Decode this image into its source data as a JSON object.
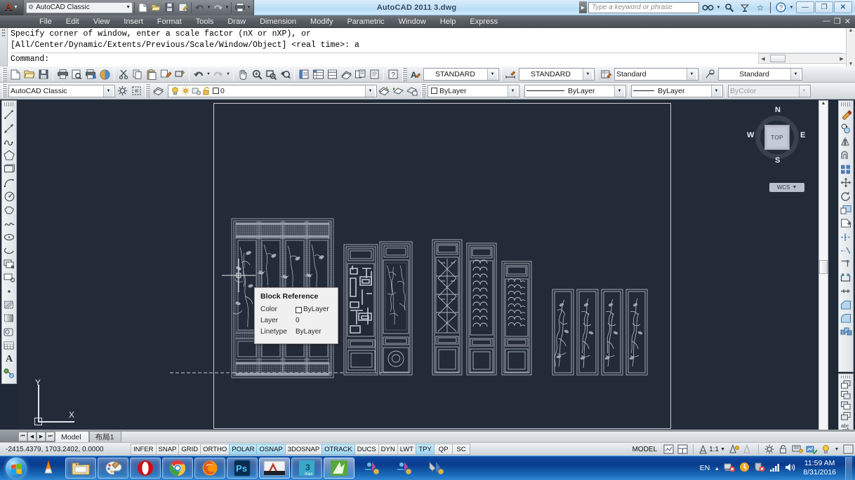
{
  "window": {
    "title": "AutoCAD 2011    3.dwg",
    "app_logo": "autocad-a-logo",
    "workspace": "AutoCAD Classic",
    "minimize": "—",
    "maximize": "❐",
    "close": "✕",
    "doc_minimize": "—",
    "doc_restore": "❐",
    "doc_close": "✕"
  },
  "quick_access": {
    "items": [
      {
        "name": "new-file-icon",
        "glyph": "🗋"
      },
      {
        "name": "open-file-icon",
        "glyph": "🗁"
      },
      {
        "name": "save-icon",
        "glyph": "💾"
      },
      {
        "name": "save-as-icon",
        "glyph": "🖫"
      },
      {
        "name": "undo-icon",
        "glyph": "↩"
      },
      {
        "name": "redo-icon",
        "glyph": "↪"
      },
      {
        "name": "plot-icon",
        "glyph": "🖶"
      }
    ]
  },
  "infocenter": {
    "search_placeholder": "Type a keyword or phrase",
    "search_value": "",
    "buttons": [
      {
        "name": "search-icon",
        "glyph": "🔍"
      },
      {
        "name": "exchange-icon",
        "glyph": "⌕"
      },
      {
        "name": "favorites-star-icon",
        "glyph": "☆"
      },
      {
        "name": "help-icon",
        "glyph": "?"
      }
    ]
  },
  "menu": {
    "items": [
      "File",
      "Edit",
      "View",
      "Insert",
      "Format",
      "Tools",
      "Draw",
      "Dimension",
      "Modify",
      "Parametric",
      "Window",
      "Help",
      "Express"
    ]
  },
  "command_line": {
    "history": [
      "Specify corner of window, enter a scale factor (nX or nXP), or",
      "[All/Center/Dynamic/Extents/Previous/Scale/Window/Object] <real time>: a"
    ],
    "prompt": "Command:"
  },
  "standard_toolbar": {
    "icons": [
      {
        "name": "new-icon",
        "glyph": "🗋"
      },
      {
        "name": "open-icon",
        "glyph": "🗁"
      },
      {
        "name": "save-icon",
        "glyph": "💾"
      },
      {
        "name": "plot-icon",
        "glyph": "🖶"
      },
      {
        "name": "plot-preview-icon",
        "glyph": "🔍"
      },
      {
        "name": "publish-icon",
        "glyph": "🖷"
      },
      {
        "name": "3dprint-icon",
        "glyph": "◍"
      },
      {
        "name": "cut-icon",
        "glyph": "✂"
      },
      {
        "name": "copy-icon",
        "glyph": "🗐"
      },
      {
        "name": "paste-icon",
        "glyph": "📋"
      },
      {
        "name": "match-properties-icon",
        "glyph": "🖌"
      },
      {
        "name": "block-editor-icon",
        "glyph": "⬚"
      },
      {
        "name": "undo-icon",
        "glyph": "↩"
      },
      {
        "name": "redo-icon",
        "glyph": "↪"
      },
      {
        "name": "pan-icon",
        "glyph": "✋"
      },
      {
        "name": "zoom-realtime-icon",
        "glyph": "🔍"
      },
      {
        "name": "zoom-window-icon",
        "glyph": "⌗"
      },
      {
        "name": "zoom-previous-icon",
        "glyph": "🔎"
      },
      {
        "name": "properties-icon",
        "glyph": "▤"
      },
      {
        "name": "designcenter-icon",
        "glyph": "▦"
      },
      {
        "name": "tool-palettes-icon",
        "glyph": "▥"
      },
      {
        "name": "sheet-set-icon",
        "glyph": "🗂"
      },
      {
        "name": "markup-set-icon",
        "glyph": "🗒"
      },
      {
        "name": "help-icon",
        "glyph": "?"
      }
    ]
  },
  "styles_toolbar": {
    "text_style": "STANDARD",
    "dim_style": "STANDARD",
    "table_style": "Standard",
    "mleader_style": "Standard"
  },
  "layers_toolbar": {
    "workspace": "AutoCAD Classic",
    "layer_name": "0",
    "layer_states": [
      "lightbulb-on-icon",
      "sun-icon",
      "freeze-icon",
      "unlock-icon"
    ]
  },
  "properties_toolbar": {
    "color": "ByLayer",
    "linetype": "ByLayer",
    "lineweight": "ByLayer",
    "plot_style": "ByColor"
  },
  "draw_toolbar": {
    "icons": [
      {
        "name": "line-icon",
        "glyph": "╱"
      },
      {
        "name": "construction-line-icon",
        "glyph": "↗"
      },
      {
        "name": "polyline-icon",
        "glyph": "⌇"
      },
      {
        "name": "polygon-icon",
        "glyph": "⬠"
      },
      {
        "name": "rectangle-icon",
        "glyph": "▭"
      },
      {
        "name": "arc-icon",
        "glyph": "◟"
      },
      {
        "name": "circle-icon",
        "glyph": "◉"
      },
      {
        "name": "revision-cloud-icon",
        "glyph": "☁"
      },
      {
        "name": "spline-icon",
        "glyph": "∿"
      },
      {
        "name": "ellipse-icon",
        "glyph": "⬭"
      },
      {
        "name": "ellipse-arc-icon",
        "glyph": "◠"
      },
      {
        "name": "insert-block-icon",
        "glyph": "⬓"
      },
      {
        "name": "make-block-icon",
        "glyph": "⬔"
      },
      {
        "name": "point-icon",
        "glyph": "•"
      },
      {
        "name": "hatch-icon",
        "glyph": "▧"
      },
      {
        "name": "gradient-icon",
        "glyph": "▨"
      },
      {
        "name": "region-icon",
        "glyph": "◇"
      },
      {
        "name": "table-icon",
        "glyph": "▦"
      },
      {
        "name": "multiline-text-icon",
        "glyph": "A"
      },
      {
        "name": "add-selected-icon",
        "glyph": "⬤"
      }
    ]
  },
  "modify_toolbar": {
    "icons": [
      {
        "name": "erase-icon",
        "glyph": "✎"
      },
      {
        "name": "copy-object-icon",
        "glyph": "◎"
      },
      {
        "name": "mirror-icon",
        "glyph": "◁"
      },
      {
        "name": "offset-icon",
        "glyph": "⊂"
      },
      {
        "name": "array-icon",
        "glyph": "▩"
      },
      {
        "name": "move-icon",
        "glyph": "✥"
      },
      {
        "name": "rotate-icon",
        "glyph": "↻"
      },
      {
        "name": "scale-icon",
        "glyph": "◰"
      },
      {
        "name": "stretch-icon",
        "glyph": "◱"
      },
      {
        "name": "trim-icon",
        "glyph": "⊣"
      },
      {
        "name": "extend-icon",
        "glyph": "⊢"
      },
      {
        "name": "break-at-point-icon",
        "glyph": "◳"
      },
      {
        "name": "break-icon",
        "glyph": "◲"
      },
      {
        "name": "join-icon",
        "glyph": "⇥"
      },
      {
        "name": "chamfer-icon",
        "glyph": "◣"
      },
      {
        "name": "fillet-icon",
        "glyph": "◜"
      },
      {
        "name": "explode-icon",
        "glyph": "✸"
      }
    ]
  },
  "order_toolbar": {
    "icons": [
      {
        "name": "bring-to-front-icon",
        "glyph": "❏"
      },
      {
        "name": "send-to-back-icon",
        "glyph": "❐"
      },
      {
        "name": "bring-above-object-icon",
        "glyph": "❑"
      },
      {
        "name": "send-under-object-icon",
        "glyph": "❒"
      },
      {
        "name": "bring-text-to-front-icon",
        "glyph": "🅰"
      },
      {
        "name": "draw-order-by-object-icon",
        "glyph": "▤"
      }
    ]
  },
  "viewcube": {
    "top_label": "TOP",
    "north": "N",
    "south": "S",
    "east": "E",
    "west": "W",
    "ucs_label": "WCS"
  },
  "ucs_icon": {
    "y_label": "Y",
    "x_label": "X"
  },
  "tooltip": {
    "title": "Block Reference",
    "rows": [
      {
        "key": "Color",
        "value": "ByLayer",
        "swatch": true
      },
      {
        "key": "Layer",
        "value": "0",
        "swatch": false
      },
      {
        "key": "Linetype",
        "value": "ByLayer",
        "swatch": false
      }
    ]
  },
  "model_tabs": {
    "nav": [
      "⏮",
      "◀",
      "▶",
      "⏭"
    ],
    "tabs": [
      {
        "label": "Model",
        "active": true
      },
      {
        "label": "布局1",
        "active": false
      }
    ]
  },
  "status_bar": {
    "coordinates": "-2415.4379, 1703.2402, 0.0000",
    "toggles": [
      {
        "label": "INFER",
        "on": false
      },
      {
        "label": "SNAP",
        "on": false
      },
      {
        "label": "GRID",
        "on": false
      },
      {
        "label": "ORTHO",
        "on": false
      },
      {
        "label": "POLAR",
        "on": true
      },
      {
        "label": "OSNAP",
        "on": true
      },
      {
        "label": "3DOSNAP",
        "on": false
      },
      {
        "label": "OTRACK",
        "on": true
      },
      {
        "label": "DUCS",
        "on": false
      },
      {
        "label": "DYN",
        "on": false
      },
      {
        "label": "LWT",
        "on": false
      },
      {
        "label": "TPY",
        "on": true
      },
      {
        "label": "QP",
        "on": false
      },
      {
        "label": "SC",
        "on": false
      }
    ],
    "space": "MODEL",
    "scale": "1:1",
    "right_icons": [
      {
        "name": "layout-icon",
        "glyph": "▣"
      },
      {
        "name": "viewport-icon",
        "glyph": "▥"
      },
      {
        "name": "annotation-scale-icon",
        "glyph": "⌬"
      },
      {
        "name": "annotation-visibility-icon",
        "glyph": "⌭"
      },
      {
        "name": "workspace-gear-icon",
        "glyph": "⚙"
      },
      {
        "name": "toolbar-lock-icon",
        "glyph": "🔓"
      },
      {
        "name": "hardware-accel-icon",
        "glyph": "🖳"
      },
      {
        "name": "isolate-objects-icon",
        "glyph": "💡"
      },
      {
        "name": "status-menu-icon",
        "glyph": "▾"
      },
      {
        "name": "clean-screen-icon",
        "glyph": "❐"
      }
    ]
  },
  "taskbar": {
    "start": "start-orb",
    "items": [
      {
        "name": "vlc-icon",
        "glyph": "▲",
        "style": "plain"
      },
      {
        "name": "explorer-icon",
        "glyph": "🗂",
        "style": "box"
      },
      {
        "name": "paint-icon",
        "glyph": "🎨",
        "style": "box"
      },
      {
        "name": "opera-icon",
        "glyph": "O",
        "style": "box"
      },
      {
        "name": "chrome-icon",
        "glyph": "◉",
        "style": "box"
      },
      {
        "name": "firefox-icon",
        "glyph": "🦊",
        "style": "box"
      },
      {
        "name": "photoshop-icon",
        "glyph": "Ps",
        "style": "box"
      },
      {
        "name": "autocad-icon",
        "glyph": "A",
        "style": "active"
      },
      {
        "name": "3dsmax-icon",
        "glyph": "3",
        "style": "box"
      },
      {
        "name": "sketchup-icon",
        "glyph": "✦",
        "style": "active"
      },
      {
        "name": "installer-icon-1",
        "glyph": "⚙",
        "style": "plain"
      },
      {
        "name": "installer-icon-2",
        "glyph": "⚙",
        "style": "plain"
      },
      {
        "name": "installer-icon-3",
        "glyph": "⚒",
        "style": "plain"
      }
    ],
    "tray": {
      "language": "EN",
      "expand": "▲",
      "icons": [
        {
          "name": "network-error-icon",
          "glyph": "🖧"
        },
        {
          "name": "update-icon",
          "glyph": "◉"
        },
        {
          "name": "security-alert-icon",
          "glyph": "🛡"
        },
        {
          "name": "signal-icon",
          "glyph": "📶"
        },
        {
          "name": "volume-icon",
          "glyph": "🔊"
        }
      ],
      "time": "11:59 AM",
      "date": "8/31/2016"
    }
  }
}
